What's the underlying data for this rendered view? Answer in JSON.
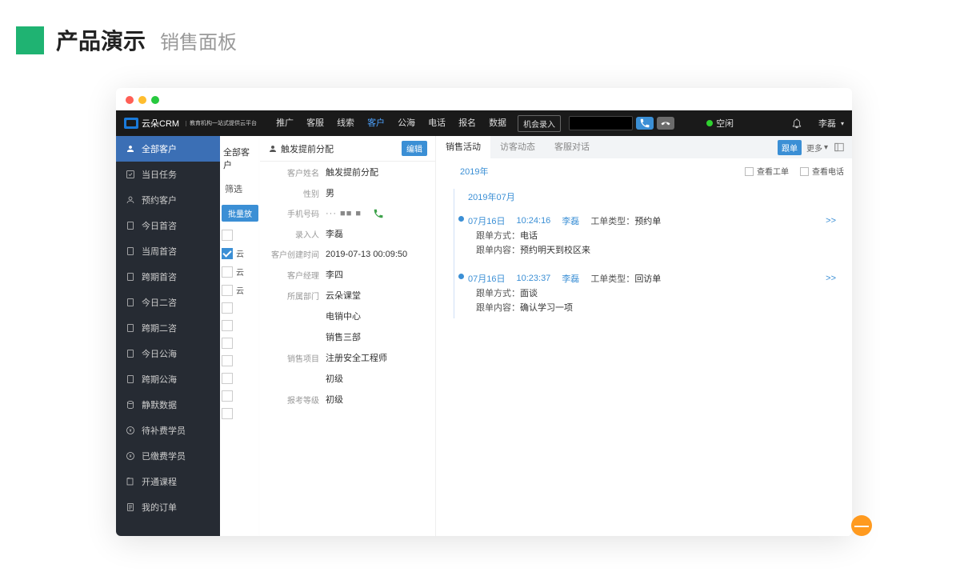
{
  "page": {
    "title": "产品演示",
    "subtitle": "销售面板"
  },
  "brand": {
    "name": "云朵CRM",
    "tagline": "教育机构一站式提供云平台"
  },
  "topnav": {
    "items": [
      "推广",
      "客服",
      "线索",
      "客户",
      "公海",
      "电话",
      "报名",
      "数据"
    ],
    "action": "机会录入"
  },
  "status": {
    "label": "空闲",
    "user": "李磊"
  },
  "sidebar": {
    "items": [
      {
        "icon": "users",
        "label": "全部客户",
        "active": true
      },
      {
        "icon": "check",
        "label": "当日任务"
      },
      {
        "icon": "person",
        "label": "预约客户"
      },
      {
        "icon": "doc",
        "label": "今日首咨"
      },
      {
        "icon": "doc",
        "label": "当周首咨"
      },
      {
        "icon": "doc",
        "label": "跨期首咨"
      },
      {
        "icon": "doc",
        "label": "今日二咨"
      },
      {
        "icon": "doc",
        "label": "跨期二咨"
      },
      {
        "icon": "doc",
        "label": "今日公海"
      },
      {
        "icon": "doc",
        "label": "跨期公海"
      },
      {
        "icon": "db",
        "label": "静默数据"
      },
      {
        "icon": "money",
        "label": "待补费学员"
      },
      {
        "icon": "money",
        "label": "已缴费学员"
      },
      {
        "icon": "book",
        "label": "开通课程"
      },
      {
        "icon": "order",
        "label": "我的订单"
      }
    ]
  },
  "leftslice": {
    "header": "全部客户",
    "filter": "筛选",
    "batch": "批量放",
    "rows": [
      "云",
      "云",
      "云"
    ]
  },
  "detail": {
    "title": "触发提前分配",
    "edit": "编辑",
    "fields": [
      {
        "label": "客户姓名",
        "value": "触发提前分配"
      },
      {
        "label": "性别",
        "value": "男"
      },
      {
        "label": "手机号码",
        "value": "",
        "phone": true
      },
      {
        "label": "录入人",
        "value": "李磊"
      },
      {
        "label": "客户创建时间",
        "value": "2019-07-13 00:09:50"
      },
      {
        "label": "客户经理",
        "value": "李四"
      },
      {
        "label": "所属部门",
        "value": "云朵课堂"
      },
      {
        "label": "",
        "value": "电销中心"
      },
      {
        "label": "",
        "value": "销售三部"
      },
      {
        "label": "销售项目",
        "value": "注册安全工程师"
      },
      {
        "label": "",
        "value": "初级"
      },
      {
        "label": "报考等级",
        "value": "初级"
      }
    ],
    "phone_mask": "··· ■■ ■"
  },
  "right": {
    "tabs": [
      "销售活动",
      "访客动态",
      "客服对话"
    ],
    "follow_btn": "跟单",
    "more": "更多",
    "tool1": "查看工单",
    "tool2": "查看电话",
    "year": "2019年",
    "month": "2019年07月",
    "entries": [
      {
        "date": "07月16日",
        "time": "10:24:16",
        "user": "李磊",
        "type_label": "工单类型：",
        "type_value": "预约单",
        "method_label": "跟单方式：",
        "method_value": "电话",
        "content_label": "跟单内容：",
        "content_value": "预约明天到校区来",
        "arrow": ">>"
      },
      {
        "date": "07月16日",
        "time": "10:23:37",
        "user": "李磊",
        "type_label": "工单类型：",
        "type_value": "回访单",
        "method_label": "跟单方式：",
        "method_value": "面谈",
        "content_label": "跟单内容：",
        "content_value": "确认学习一项",
        "arrow": ">>"
      }
    ]
  },
  "fab": "—"
}
